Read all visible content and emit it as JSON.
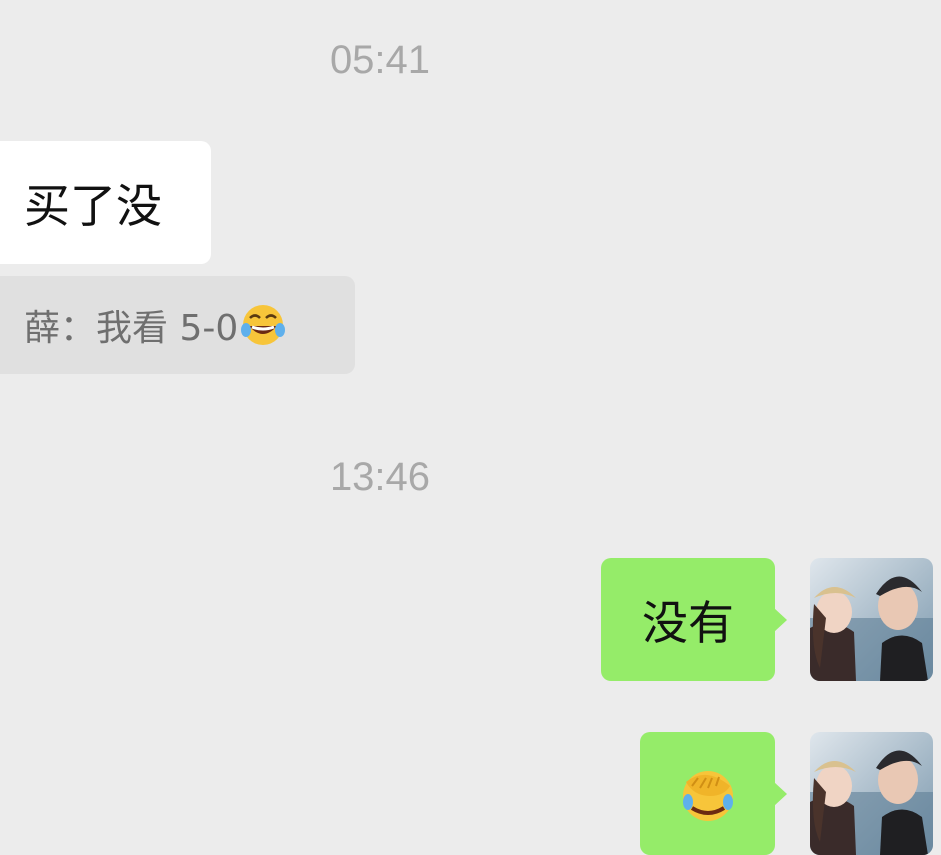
{
  "chat": {
    "timestamps": [
      "05:41",
      "13:46"
    ],
    "incoming": {
      "text": "买了没"
    },
    "quote": {
      "text": "薛：我看 5-0",
      "emoji_icon": "tears-of-joy-emoji-icon"
    },
    "outgoing": [
      {
        "text": "没有"
      },
      {
        "text": "",
        "emoji_icon": "facepalm-emoji-icon"
      }
    ]
  },
  "colors": {
    "background": "#ececec",
    "incoming_bubble": "#ffffff",
    "outgoing_bubble": "#95ec69",
    "quote_bubble": "#e0e0e0",
    "timestamp_text": "#a8a8a8"
  }
}
